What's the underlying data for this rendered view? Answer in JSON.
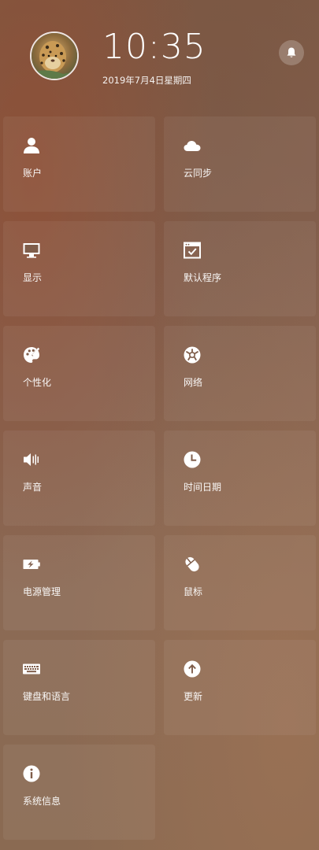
{
  "header": {
    "time": "10:35",
    "date": "2019年7月4日星期四",
    "avatar_icon": "user-avatar-leopard",
    "notification_icon": "bell-icon"
  },
  "tiles": [
    {
      "label": "账户",
      "icon": "account-icon"
    },
    {
      "label": "云同步",
      "icon": "cloud-icon"
    },
    {
      "label": "显示",
      "icon": "monitor-icon"
    },
    {
      "label": "默认程序",
      "icon": "default-app-icon"
    },
    {
      "label": "个性化",
      "icon": "palette-icon"
    },
    {
      "label": "网络",
      "icon": "network-icon"
    },
    {
      "label": "声音",
      "icon": "speaker-icon"
    },
    {
      "label": "时间日期",
      "icon": "clock-icon"
    },
    {
      "label": "电源管理",
      "icon": "battery-icon"
    },
    {
      "label": "鼠标",
      "icon": "mouse-icon"
    },
    {
      "label": "键盘和语言",
      "icon": "keyboard-icon"
    },
    {
      "label": "更新",
      "icon": "update-icon"
    },
    {
      "label": "系统信息",
      "icon": "info-icon"
    }
  ]
}
